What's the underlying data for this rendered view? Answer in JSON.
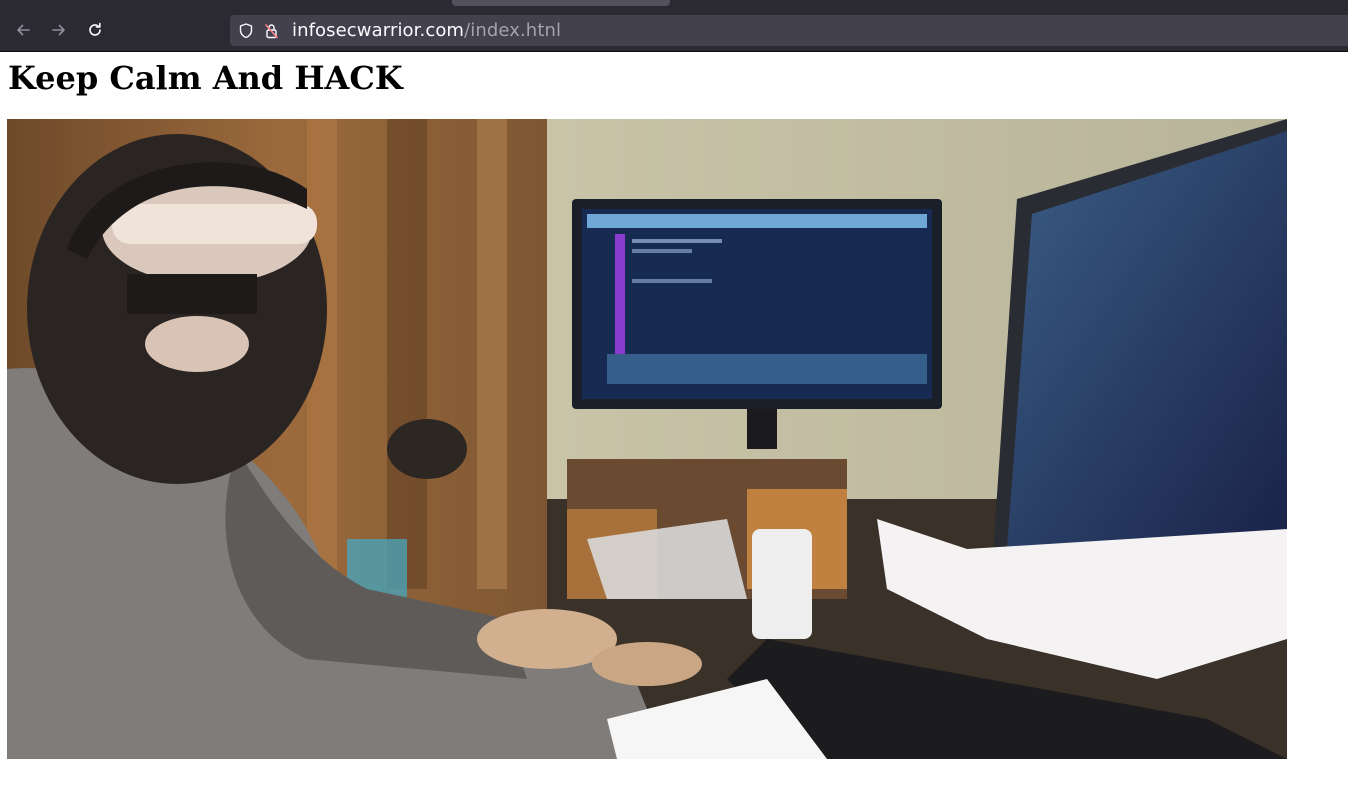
{
  "browser": {
    "url_host": "infosecwarrior.com",
    "url_path": "/index.htnl",
    "icons": [
      "back-arrow-icon",
      "forward-arrow-icon",
      "reload-icon",
      "shield-icon",
      "lock-insecure-icon"
    ]
  },
  "page": {
    "heading": "Keep Calm And HACK",
    "image_alt": "hacker-gif"
  },
  "colors": {
    "chrome_bg": "#2b2a33",
    "urlbar_bg": "#42414d",
    "url_text": "#fbfbfe",
    "url_path_text": "#a4a3ab",
    "insecure_lock": "#ff848b"
  }
}
